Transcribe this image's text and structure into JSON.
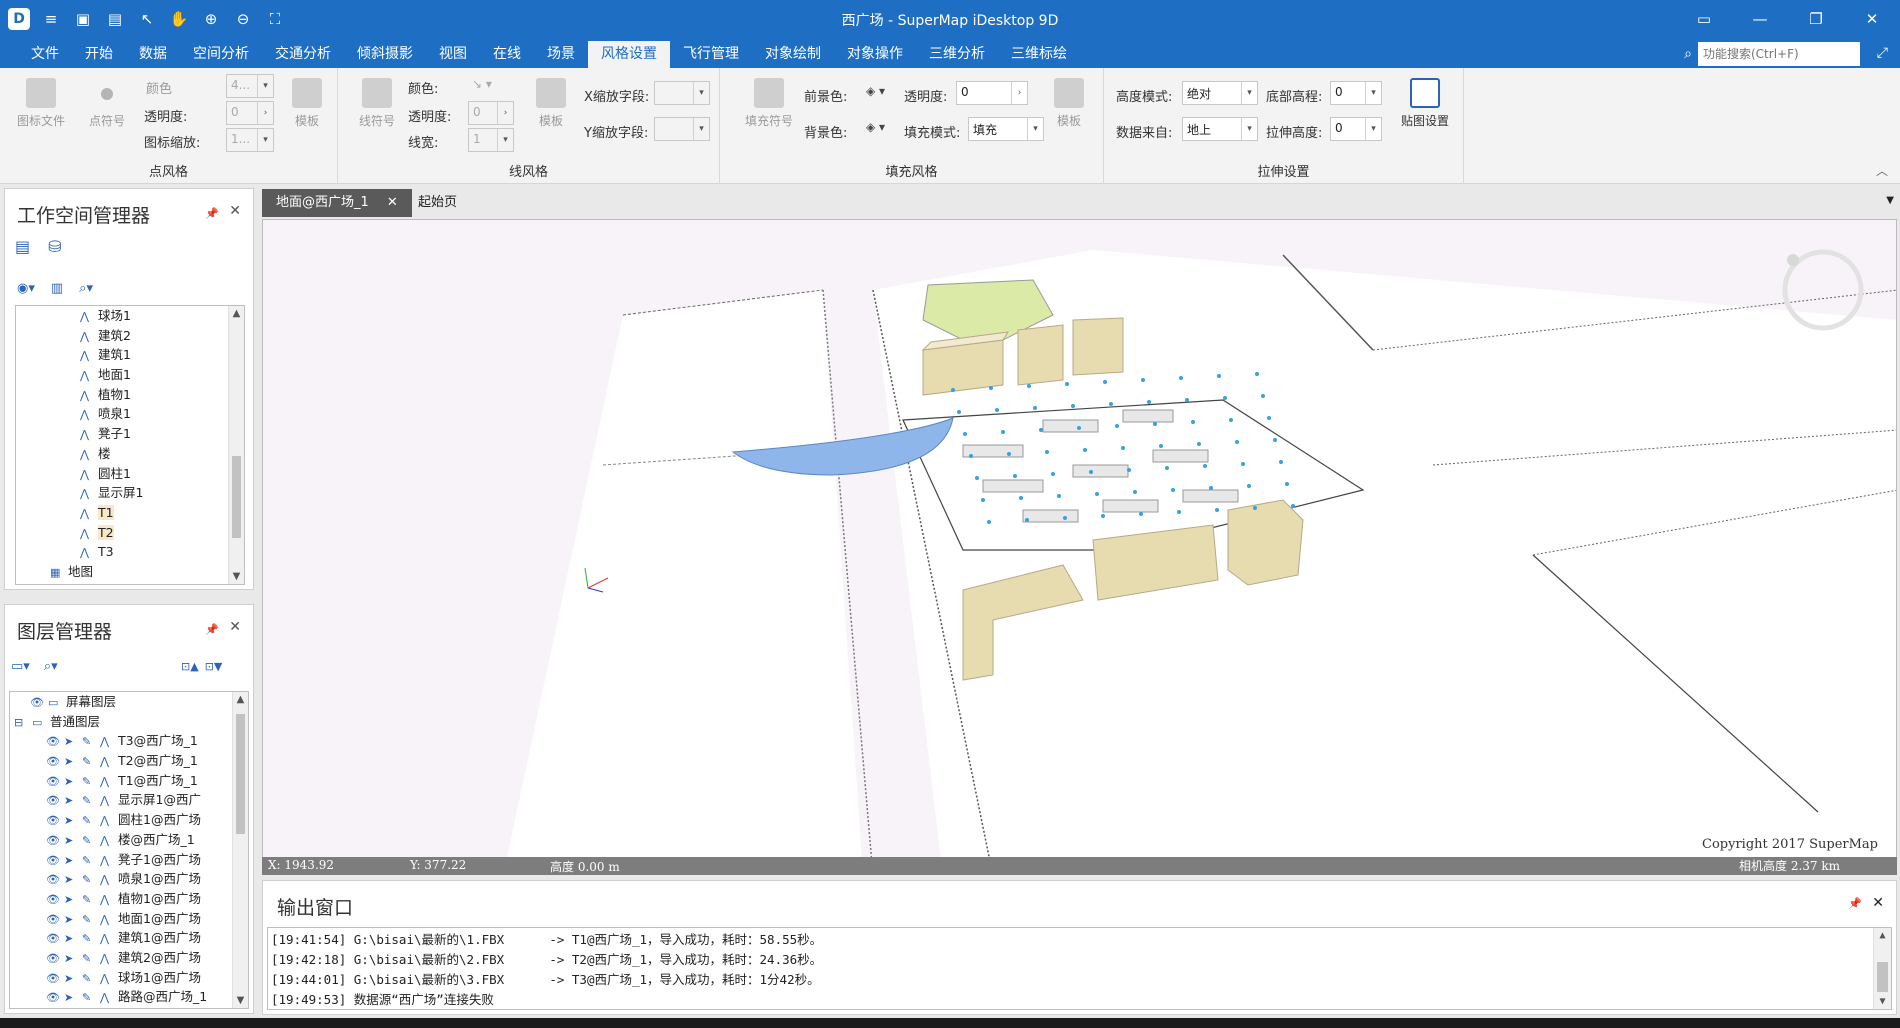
{
  "app": {
    "title": "西广场 - SuperMap iDesktop 9D",
    "logo": "D"
  },
  "menu": {
    "tabs": [
      "文件",
      "开始",
      "数据",
      "空间分析",
      "交通分析",
      "倾斜摄影",
      "视图",
      "在线",
      "场景",
      "风格设置",
      "飞行管理",
      "对象绘制",
      "对象操作",
      "三维分析",
      "三维标绘"
    ],
    "active": "风格设置",
    "search_placeholder": "功能搜索(Ctrl+F)"
  },
  "ribbon": {
    "point_style": {
      "title": "点风格",
      "icon_file": "图标文件",
      "point_symbol": "点符号",
      "color_label": "颜色",
      "color_value": "4...",
      "transparency_label": "透明度:",
      "transparency_value": "0",
      "icon_scale_label": "图标缩放:",
      "icon_scale_value": "1...",
      "template": "模板"
    },
    "line_style": {
      "title": "线风格",
      "line_symbol": "线符号",
      "color_label": "颜色:",
      "transparency_label": "透明度:",
      "transparency_value": "0",
      "width_label": "线宽:",
      "width_value": "1",
      "template": "模板",
      "x_scale_label": "X缩放字段:",
      "y_scale_label": "Y缩放字段:"
    },
    "fill_style": {
      "title": "填充风格",
      "fill_symbol": "填充符号",
      "fg_color_label": "前景色:",
      "bg_color_label": "背景色:",
      "transparency_label": "透明度:",
      "transparency_value": "0",
      "fill_mode_label": "填充模式:",
      "fill_mode_value": "填充",
      "template": "模板"
    },
    "extrude": {
      "title": "拉伸设置",
      "height_mode_label": "高度模式:",
      "height_mode_value": "绝对",
      "data_source_label": "数据来自:",
      "data_source_value": "地上",
      "base_elev_label": "底部高程:",
      "base_elev_value": "0",
      "extrude_height_label": "拉伸高度:",
      "extrude_height_value": "0",
      "texture": "贴图设置"
    }
  },
  "workspace": {
    "title": "工作空间管理器",
    "items": [
      "球场1",
      "建筑2",
      "建筑1",
      "地面1",
      "植物1",
      "喷泉1",
      "凳子1",
      "楼",
      "圆柱1",
      "显示屏1",
      "T1",
      "T2",
      "T3"
    ],
    "map_node": "地图"
  },
  "layers": {
    "title": "图层管理器",
    "screen_layer": "屏幕图层",
    "normal_layer": "普通图层",
    "items": [
      "T3@西广场_1",
      "T2@西广场_1",
      "T1@西广场_1",
      "显示屏1@西广",
      "圆柱1@西广场",
      "楼@西广场_1",
      "凳子1@西广场",
      "喷泉1@西广场",
      "植物1@西广场",
      "地面1@西广场",
      "建筑1@西广场",
      "建筑2@西广场",
      "球场1@西广场",
      "路路@西广场_1"
    ]
  },
  "doc_tabs": {
    "active": "地面@西广场_1",
    "start": "起始页"
  },
  "status": {
    "x": "X: 1943.92",
    "y": "Y: 377.22",
    "h": "高度 0.00 m",
    "copyright": "Copyright 2017 SuperMap",
    "camera": "相机高度 2.37 km"
  },
  "output": {
    "title": "输出窗口",
    "lines": [
      "[19:41:54] G:\\bisai\\最新的\\1.FBX      -> T1@西广场_1，导入成功，耗时：58.55秒。",
      "[19:42:18] G:\\bisai\\最新的\\2.FBX      -> T2@西广场_1，导入成功，耗时：24.36秒。",
      "[19:44:01] G:\\bisai\\最新的\\3.FBX      -> T3@西广场_1，导入成功，耗时：1分42秒。",
      "[19:49:53] 数据源“西广场”连接失败"
    ]
  },
  "colors": {
    "accent": "#1e6fc4",
    "building": "#e6dcb0",
    "dome": "#8fb6ea",
    "park": "#dbeaa6"
  }
}
